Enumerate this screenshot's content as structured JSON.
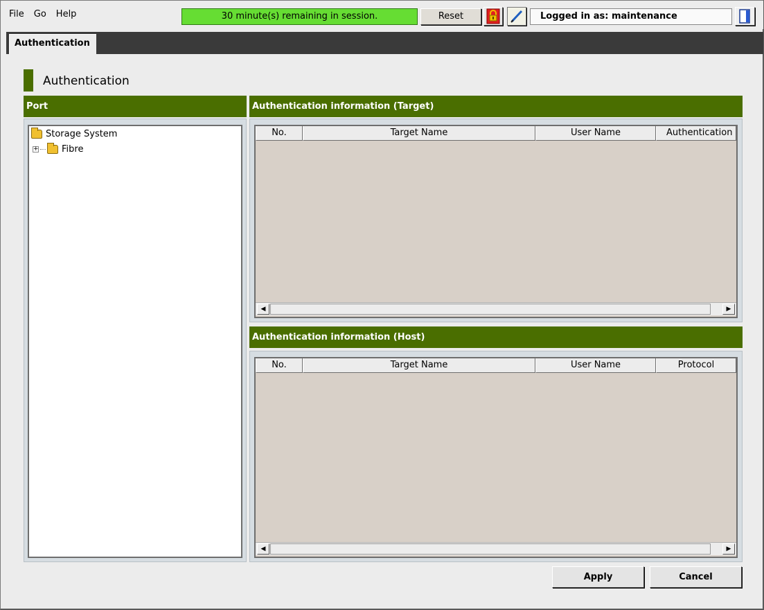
{
  "menu": {
    "file": "File",
    "go": "Go",
    "help": "Help"
  },
  "session": {
    "remaining": "30 minute(s) remaining in session.",
    "reset_label": "Reset"
  },
  "user": {
    "logged_in_as": "Logged in as: maintenance"
  },
  "tabs": [
    {
      "label": "Authentication"
    }
  ],
  "page_title": "Authentication",
  "port": {
    "header": "Port",
    "tree": [
      {
        "label": "Storage System",
        "level": 0
      },
      {
        "label": "Fibre",
        "level": 1,
        "expander": "+"
      }
    ]
  },
  "target_section": {
    "header": "Authentication information (Target)",
    "columns": [
      "No.",
      "Target Name",
      "User Name",
      "Authentication"
    ],
    "rows": []
  },
  "host_section": {
    "header": "Authentication information (Host)",
    "columns": [
      "No.",
      "Target Name",
      "User Name",
      "Protocol"
    ],
    "rows": []
  },
  "scroll": {
    "left_arrow": "◀",
    "right_arrow": "▶"
  },
  "actions": {
    "apply": "Apply",
    "cancel": "Cancel"
  },
  "colors": {
    "accent_green": "#4a6e00",
    "session_green": "#66dd33",
    "table_bg": "#d8d0c8"
  },
  "icons": {
    "lock": "lock-icon",
    "edit": "pen-icon",
    "exit": "exit-icon",
    "folder": "folder-icon"
  }
}
